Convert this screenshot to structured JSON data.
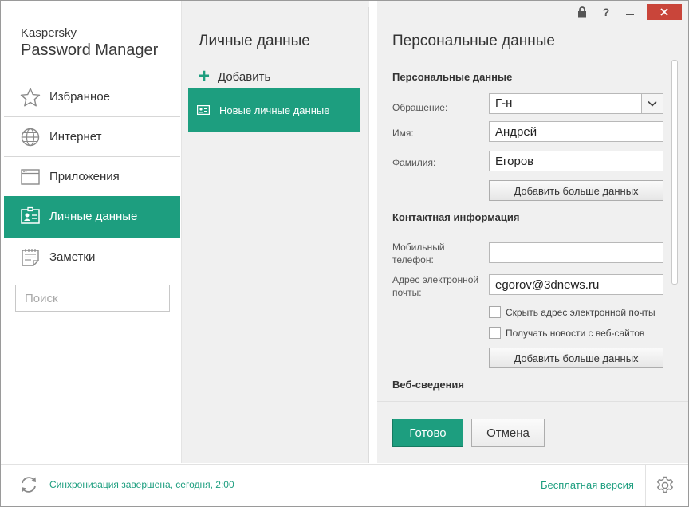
{
  "app": {
    "brand_line1": "Kaspersky",
    "brand_line2": "Password Manager"
  },
  "sidebar": {
    "items": [
      {
        "label": "Избранное",
        "icon": "star-icon"
      },
      {
        "label": "Интернет",
        "icon": "globe-icon"
      },
      {
        "label": "Приложения",
        "icon": "window-icon"
      },
      {
        "label": "Личные данные",
        "icon": "id-card-icon",
        "active": true
      },
      {
        "label": "Заметки",
        "icon": "notepad-icon"
      }
    ],
    "search_placeholder": "Поиск"
  },
  "middle": {
    "title": "Личные данные",
    "add_label": "Добавить",
    "entries": [
      {
        "label": "Новые личные данные",
        "icon": "id-card-icon"
      }
    ]
  },
  "titlebar": {
    "lock": "lock-icon",
    "help": "?",
    "minimize": "minimize-icon",
    "close": "close-icon"
  },
  "panel": {
    "title": "Персональные данные",
    "section_personal": "Персональные данные",
    "salutation_label": "Обращение:",
    "salutation_value": "Г-н",
    "firstname_label": "Имя:",
    "firstname_value": "Андрей",
    "lastname_label": "Фамилия:",
    "lastname_value": "Егоров",
    "add_more_label": "Добавить больше данных",
    "section_contact": "Контактная информация",
    "mobile_label_1": "Мобильный",
    "mobile_label_2": "телефон:",
    "mobile_value": "",
    "email_label_1": "Адрес электронной",
    "email_label_2": "почты:",
    "email_value": "egorov@3dnews.ru",
    "hide_email_label": "Скрыть адрес электронной почты",
    "news_label": "Получать новости с веб-сайтов",
    "add_more_label_2": "Добавить больше данных",
    "section_web": "Веб-сведения",
    "ok_label": "Готово",
    "cancel_label": "Отмена"
  },
  "footer": {
    "sync_text": "Синхронизация завершена, сегодня, 2:00",
    "free_version": "Бесплатная версия"
  },
  "colors": {
    "accent": "#1d9e7f",
    "close": "#c9453a",
    "background": "#f0f0f0"
  }
}
